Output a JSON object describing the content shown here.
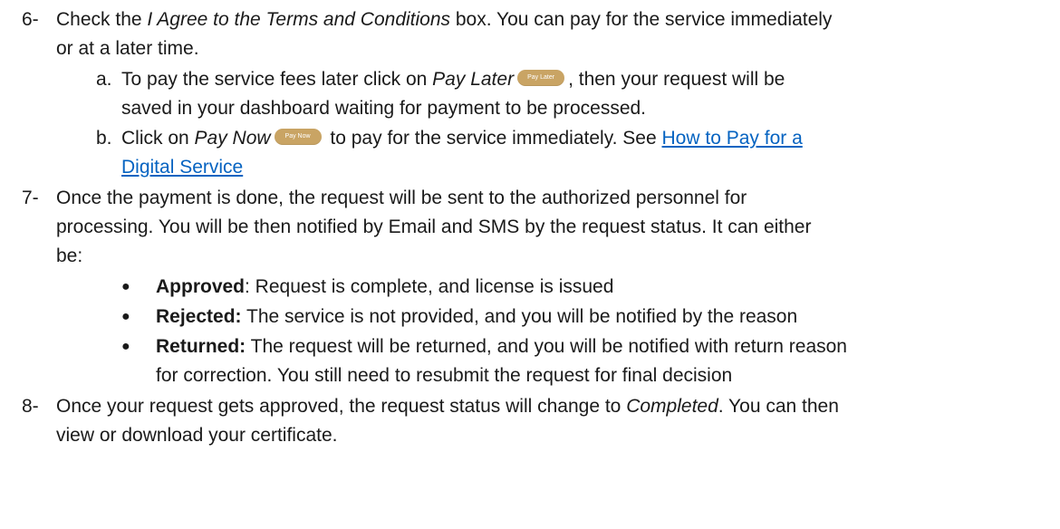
{
  "step6": {
    "num": "6-",
    "pre": "Check the ",
    "terms": "I Agree to the Terms and Conditions",
    "post": " box. You can pay for the service immediately",
    "line2": "or at a later time.",
    "a": {
      "label": "a.",
      "pre": "To pay the service fees later click on ",
      "pay_later": "Pay Later",
      "button": "Pay Later",
      "post": ", then your request will be",
      "line2": "saved in your dashboard waiting for payment to be processed."
    },
    "b": {
      "label": "b.",
      "pre": "Click on ",
      "pay_now": "Pay Now",
      "button": "Pay Now",
      "post": " to pay for the service immediately. See ",
      "link1": "How to Pay for a",
      "link2": "Digital Service"
    }
  },
  "step7": {
    "num": "7-",
    "line1": "Once the payment is done, the request will be sent to the authorized personnel for",
    "line2": "processing. You will be then notified by Email and SMS by the request status. It can either",
    "line3": "be:",
    "items": [
      {
        "label": "Approved",
        "text": ": Request is complete, and license is issued"
      },
      {
        "label": "Rejected:",
        "text": " The service is not provided, and you will be notified by the reason"
      },
      {
        "label": "Returned:",
        "text": " The request will be returned, and you will be notified with return reason",
        "text2": "for correction. You still need to resubmit the request for final decision"
      }
    ]
  },
  "step8": {
    "num": "8-",
    "pre": "Once your request gets approved, the request status will change to ",
    "completed": "Completed",
    "post": ". You can then",
    "line2": "view or download your certificate."
  },
  "colors": {
    "button": "#c9a464",
    "link": "#0563c1"
  }
}
